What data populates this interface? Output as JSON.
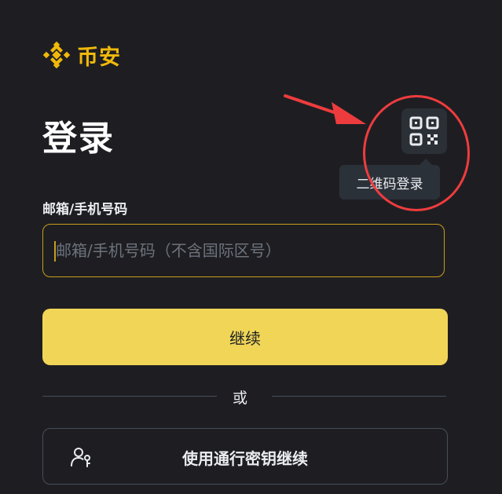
{
  "brand": {
    "name": "币安",
    "color": "#f0b90b"
  },
  "page": {
    "title": "登录"
  },
  "qr_login": {
    "icon": "qr-code-icon",
    "tooltip": "二维码登录"
  },
  "email_field": {
    "label": "邮箱/手机号码",
    "placeholder": "邮箱/手机号码（不含国际区号）",
    "value": ""
  },
  "continue_button": {
    "label": "继续",
    "color": "#f0d557"
  },
  "divider": {
    "text": "或"
  },
  "passkey_button": {
    "label": "使用通行密钥继续",
    "icon": "passkey-user-icon"
  },
  "annotation": {
    "color": "#ee3c3e"
  }
}
